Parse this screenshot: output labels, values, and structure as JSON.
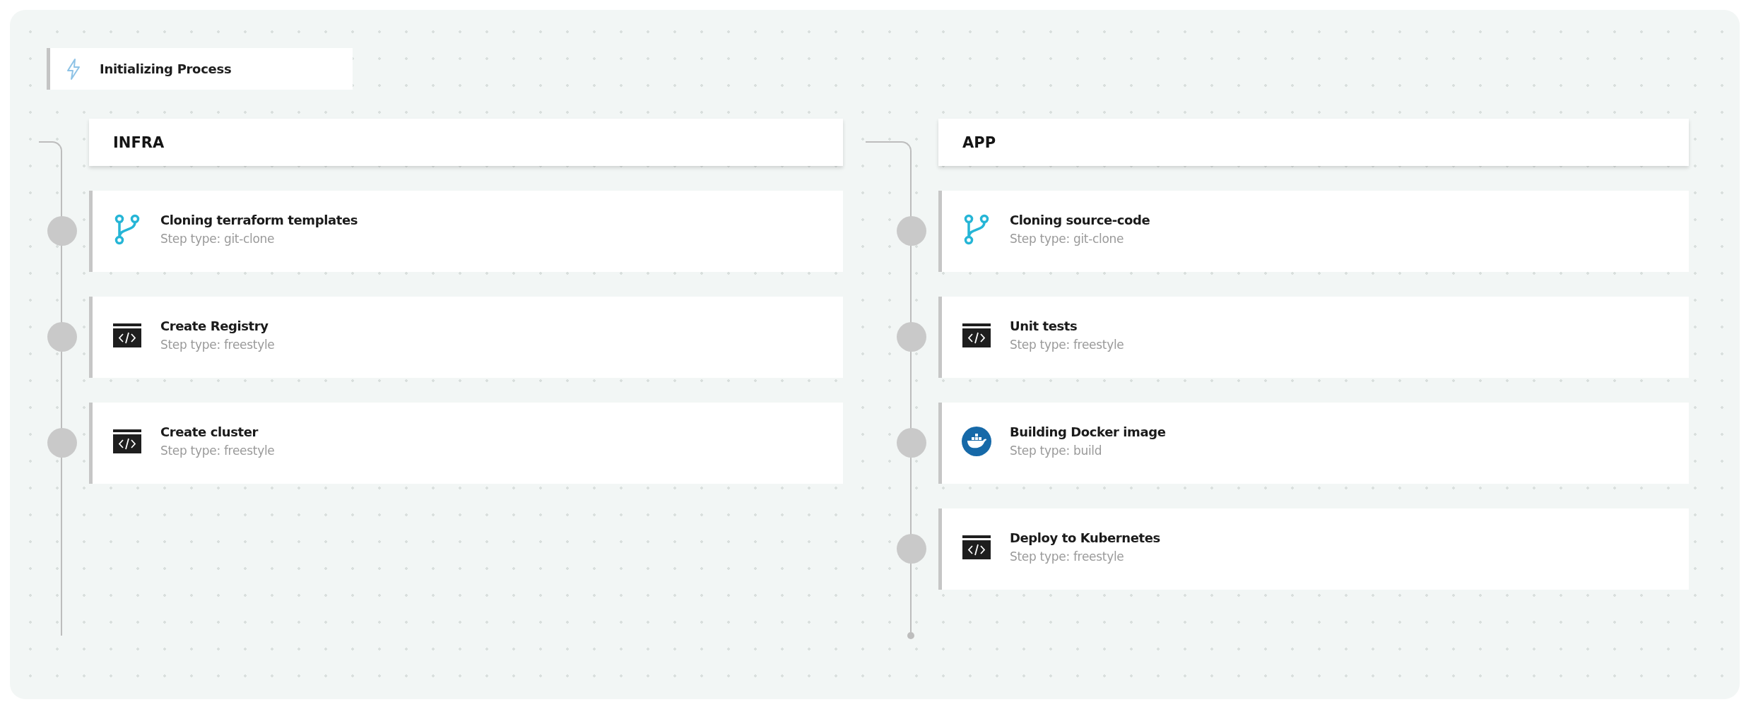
{
  "start": {
    "title": "Initializing Process"
  },
  "lanes": [
    {
      "title": "INFRA",
      "end_dot": false,
      "steps": [
        {
          "kind": "git",
          "title": "Cloning terraform templates",
          "subtitle": "Step type: git-clone"
        },
        {
          "kind": "code",
          "title": "Create Registry",
          "subtitle": "Step type: freestyle"
        },
        {
          "kind": "code",
          "title": "Create cluster",
          "subtitle": "Step type: freestyle"
        }
      ]
    },
    {
      "title": "APP",
      "end_dot": true,
      "steps": [
        {
          "kind": "git",
          "title": "Cloning source-code",
          "subtitle": "Step type: git-clone"
        },
        {
          "kind": "code",
          "title": "Unit tests",
          "subtitle": "Step type: freestyle"
        },
        {
          "kind": "docker",
          "title": "Building Docker image",
          "subtitle": "Step type: build"
        },
        {
          "kind": "code",
          "title": "Deploy to Kubernetes",
          "subtitle": "Step type: freestyle"
        }
      ]
    }
  ]
}
